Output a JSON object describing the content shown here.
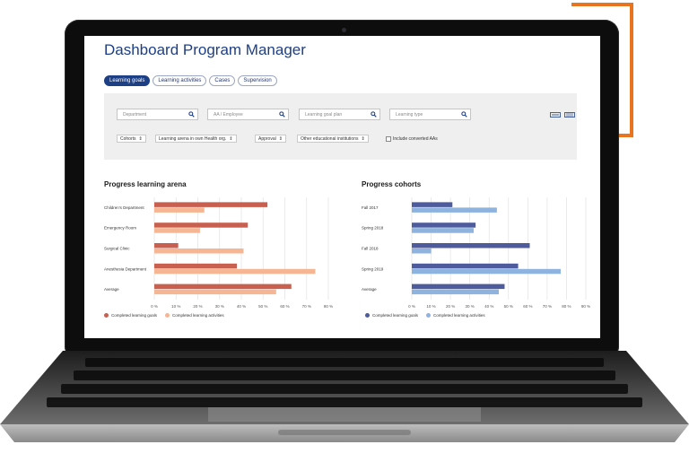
{
  "dashboard": {
    "title": "Dashboard Program Manager"
  },
  "tabs": [
    {
      "label": "Learning goals",
      "active": true
    },
    {
      "label": "Learning activities",
      "active": false
    },
    {
      "label": "Cases",
      "active": false
    },
    {
      "label": "Supervision",
      "active": false
    }
  ],
  "filters": {
    "search_fields": [
      {
        "placeholder": "Department"
      },
      {
        "placeholder": "AA / Employee"
      },
      {
        "placeholder": "Learning goal plan"
      },
      {
        "placeholder": "Learning type"
      }
    ],
    "dropdowns": [
      {
        "label": "Cohorts"
      },
      {
        "label": "Learning arena in own Health org."
      },
      {
        "label": "Approval"
      },
      {
        "label": "Other educational institutions"
      }
    ],
    "checkbox_label": "Include converted AAs"
  },
  "colors": {
    "brand_blue": "#1d3f86",
    "accent_orange": "#e8741f",
    "series_red": "#c9604f",
    "series_salmon": "#f6b593",
    "series_navy": "#4e5b9d",
    "series_lightblue": "#8db3de"
  },
  "chart_data": [
    {
      "type": "bar",
      "orientation": "horizontal",
      "title": "Progress learning arena",
      "categories": [
        "Children's Department",
        "Emergency Room",
        "Surgical Clinic",
        "Anesthesia Department",
        "Average"
      ],
      "series": [
        {
          "name": "Completed learning goals",
          "values": [
            52,
            43,
            11,
            38,
            63
          ],
          "color": "#c9604f"
        },
        {
          "name": "Completed learning activities",
          "values": [
            23,
            21,
            41,
            74,
            56
          ],
          "color": "#f6b593"
        }
      ],
      "xlim": [
        0,
        80
      ],
      "xticks": [
        "0 %",
        "10 %",
        "20 %",
        "30 %",
        "40 %",
        "50 %",
        "60 %",
        "70 %",
        "80 %"
      ],
      "grid": true,
      "legend": "bottom"
    },
    {
      "type": "bar",
      "orientation": "horizontal",
      "title": "Progress cohorts",
      "categories": [
        "Fall 2017",
        "Spring 2018",
        "Fall 2018",
        "Spring 2019",
        "Average"
      ],
      "series": [
        {
          "name": "Completed learning goals",
          "values": [
            21,
            33,
            61,
            55,
            48
          ],
          "color": "#4e5b9d"
        },
        {
          "name": "Completed learning activities",
          "values": [
            44,
            32,
            10,
            77,
            45
          ],
          "color": "#8db3de"
        }
      ],
      "xlim": [
        0,
        90
      ],
      "xticks": [
        "0 %",
        "10 %",
        "20 %",
        "30 %",
        "40 %",
        "50 %",
        "60 %",
        "70 %",
        "80 %",
        "90 %"
      ],
      "grid": true,
      "legend": "bottom"
    }
  ]
}
